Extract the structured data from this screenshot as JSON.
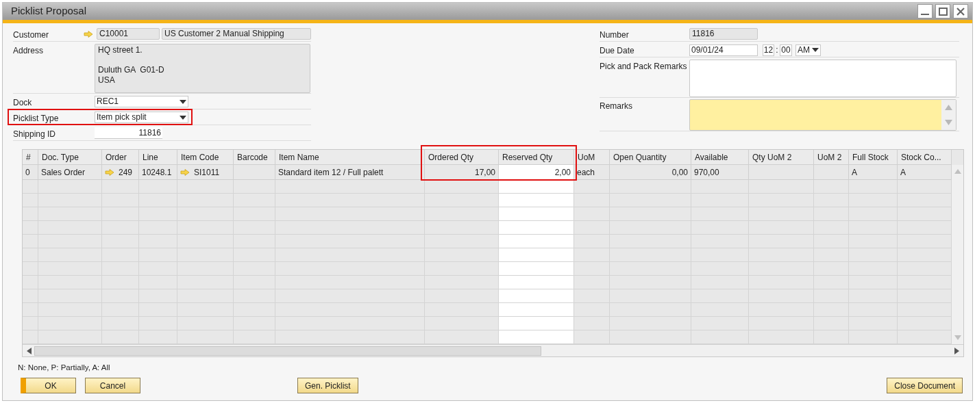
{
  "window": {
    "title": "Picklist Proposal"
  },
  "left_fields": [
    {
      "kind": "link",
      "label": "Customer",
      "values": [
        "C10001",
        "US Customer 2 Manual Shipping"
      ],
      "highlighted": false
    },
    {
      "kind": "multiline",
      "label": "Address",
      "value": "HQ street 1.\n\nDuluth GA  G01-D\nUSA",
      "highlighted": false
    },
    {
      "kind": "dropdown",
      "label": "Dock",
      "value": "REC1",
      "highlighted": false
    },
    {
      "kind": "dropdown",
      "label": "Picklist Type",
      "value": "Item pick split",
      "highlighted": true
    },
    {
      "kind": "number",
      "label": "Shipping ID",
      "value": "11816",
      "highlighted": false
    }
  ],
  "right_fields": [
    {
      "kind": "readonly",
      "label": "Number",
      "value": "11816"
    },
    {
      "kind": "datetime",
      "label": "Due Date",
      "value": "09/01/24",
      "hour": "12",
      "separator": ":",
      "minute": "00",
      "ampm": "AM"
    },
    {
      "kind": "textarea",
      "label": "Pick and Pack Remarks"
    },
    {
      "kind": "remarks",
      "label": "Remarks"
    }
  ],
  "table": {
    "columns": [
      {
        "label": "#",
        "numeric": false,
        "editable": false,
        "highlighted": false,
        "link": false
      },
      {
        "label": "Doc. Type",
        "numeric": false,
        "editable": false,
        "highlighted": false,
        "link": false
      },
      {
        "label": "Order",
        "numeric": false,
        "editable": false,
        "highlighted": false,
        "link": true
      },
      {
        "label": "Line",
        "numeric": false,
        "editable": false,
        "highlighted": false,
        "link": false
      },
      {
        "label": "Item Code",
        "numeric": false,
        "editable": false,
        "highlighted": false,
        "link": true
      },
      {
        "label": "Barcode",
        "editable": false,
        "highlighted": false
      },
      {
        "label": "Item Name",
        "numeric": false,
        "editable": false,
        "highlighted": false,
        "link": false
      },
      {
        "label": "Ordered Qty",
        "numeric": true,
        "editable": false,
        "highlighted": true,
        "link": false
      },
      {
        "label": "Reserved Qty",
        "numeric": true,
        "editable": true,
        "highlighted": true,
        "link": false
      },
      {
        "label": "UoM",
        "numeric": false,
        "editable": false,
        "highlighted": false,
        "link": false
      },
      {
        "label": "Open Quantity",
        "numeric": true,
        "editable": false,
        "highlighted": false,
        "link": false
      },
      {
        "label": "Available",
        "numeric": false,
        "editable": false,
        "highlighted": false,
        "link": false
      },
      {
        "label": "Qty UoM 2",
        "editable": false,
        "highlighted": false
      },
      {
        "label": "UoM 2",
        "editable": false,
        "highlighted": false
      },
      {
        "label": "Full Stock",
        "numeric": false,
        "editable": false,
        "highlighted": false,
        "link": false
      },
      {
        "label": "Stock Co...",
        "numeric": false,
        "editable": false,
        "highlighted": false,
        "link": false
      }
    ],
    "rows": [
      [
        "0",
        "Sales Order",
        "249",
        "10248.1",
        "SI1011",
        null,
        "Standard item 12 / Full palett",
        "17,00",
        "2,00",
        "each",
        "0,00",
        "970,00",
        null,
        null,
        "A",
        "A"
      ]
    ]
  },
  "legend": "N: None, P: Partially, A: All",
  "buttons": [
    {
      "label": "OK",
      "kind": "default"
    },
    {
      "label": "Cancel",
      "kind": "normal"
    },
    {
      "label": "Gen. Picklist",
      "kind": "normal"
    },
    {
      "label": "Close Document",
      "kind": "normal"
    }
  ]
}
